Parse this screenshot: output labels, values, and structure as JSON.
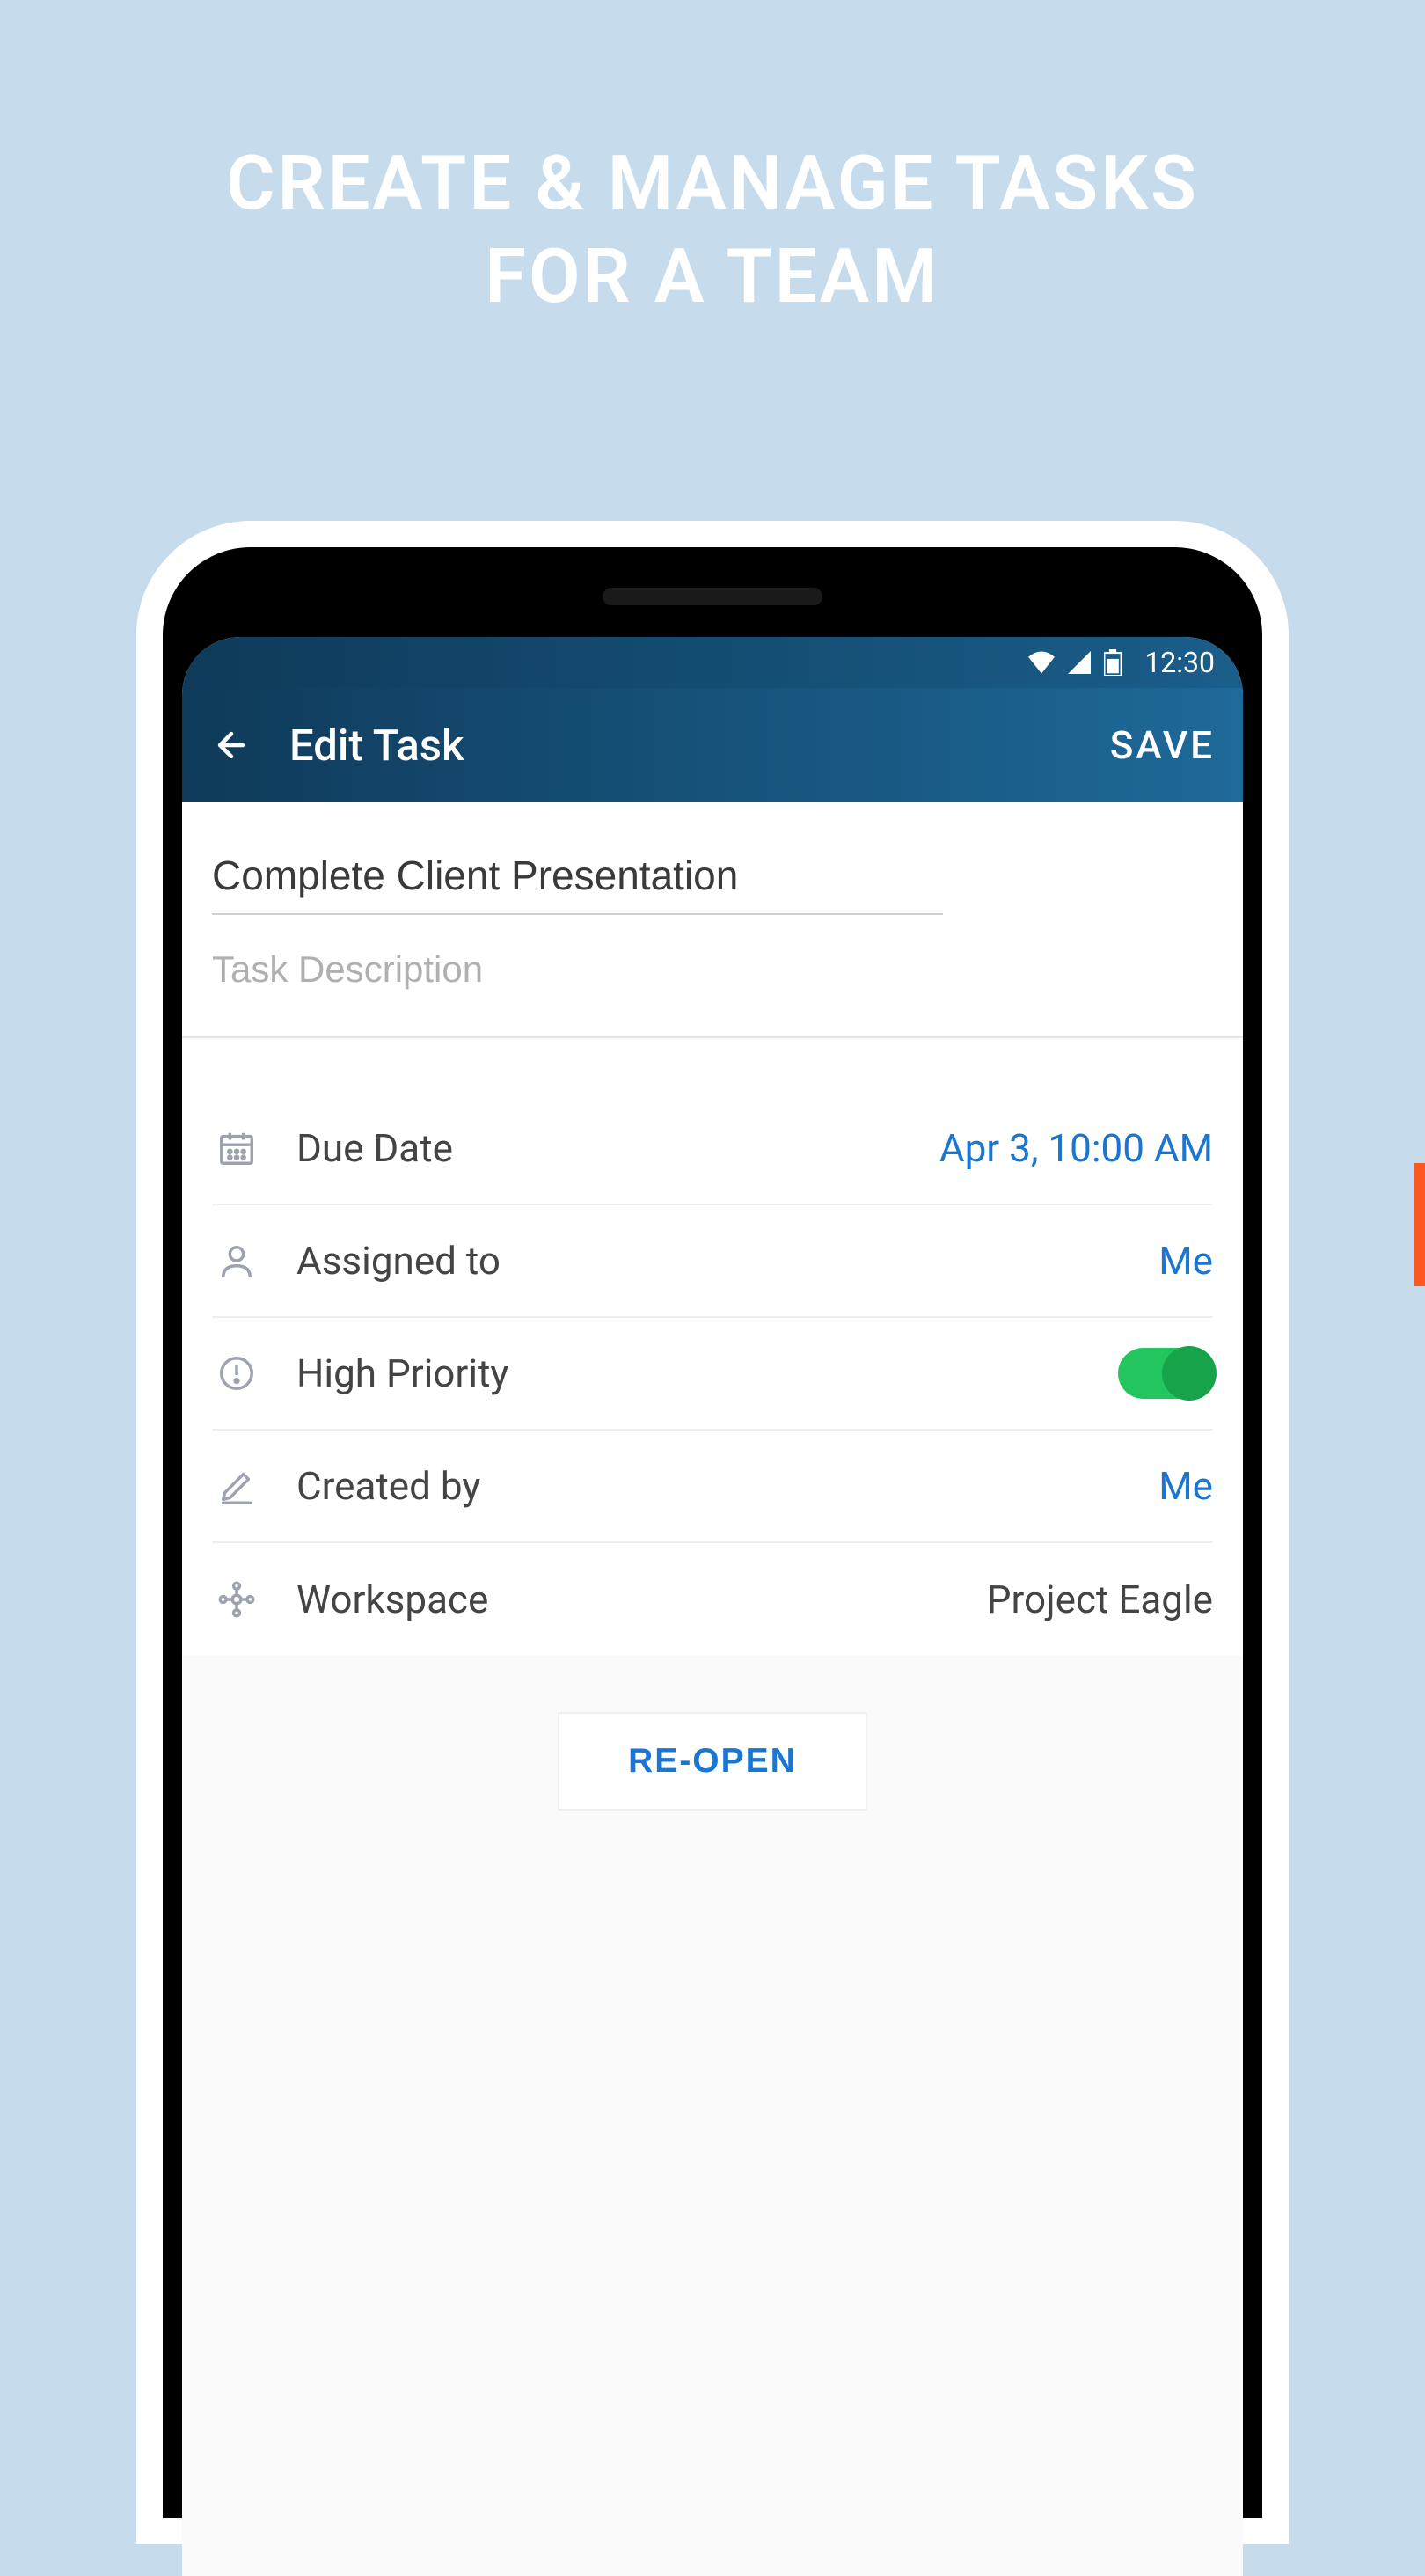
{
  "hero": {
    "line1": "CREATE & MANAGE TASKS",
    "line2": "FOR A TEAM"
  },
  "status_bar": {
    "time": "12:30"
  },
  "app_bar": {
    "title": "Edit Task",
    "save_label": "SAVE"
  },
  "task": {
    "title": "Complete Client Presentation",
    "description_placeholder": "Task Description"
  },
  "rows": {
    "due_date": {
      "label": "Due Date",
      "value": "Apr 3, 10:00 AM"
    },
    "assigned_to": {
      "label": "Assigned to",
      "value": "Me"
    },
    "high_priority": {
      "label": "High Priority"
    },
    "created_by": {
      "label": "Created by",
      "value": "Me"
    },
    "workspace": {
      "label": "Workspace",
      "value": "Project Eagle"
    }
  },
  "actions": {
    "reopen_label": "RE-OPEN"
  }
}
